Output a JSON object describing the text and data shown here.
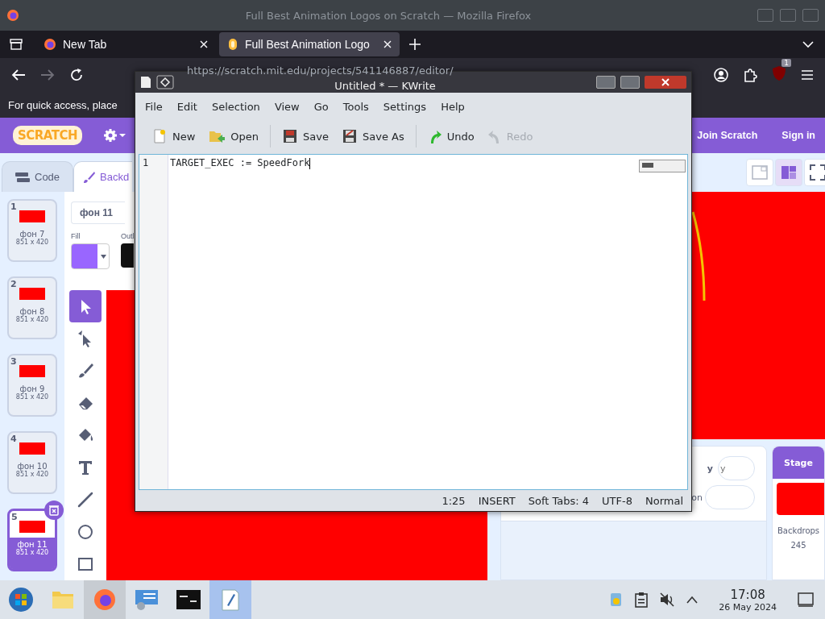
{
  "firefox": {
    "title": "Full Best Animation Logos on Scratch — Mozilla Firefox",
    "tabs": [
      {
        "label": "New Tab",
        "kind": "firefox",
        "selected": false
      },
      {
        "label": "Full Best Animation Logo",
        "kind": "scratch",
        "selected": true
      }
    ],
    "url": "https://scratch.mit.edu/projects/541146887/editor/",
    "extension_badge": "1",
    "bookmarks_hint": "For quick access, place"
  },
  "scratch": {
    "logo": "SCRATCH",
    "header_links": [
      "Join Scratch",
      "Sign in"
    ],
    "editor_tabs": [
      {
        "label": "Code",
        "kind": "code",
        "selected": false
      },
      {
        "label": "Backd",
        "kind": "backdrops",
        "selected": true
      }
    ],
    "stage_modes": [
      {
        "kind": "small",
        "selected": false
      },
      {
        "kind": "normal",
        "selected": true
      },
      {
        "kind": "fullscreen",
        "selected": false
      }
    ],
    "backdrops": [
      {
        "number": "1",
        "name": "фон 7",
        "size": "851 x 420",
        "selected": false
      },
      {
        "number": "2",
        "name": "фон 8",
        "size": "851 x 420",
        "selected": false
      },
      {
        "number": "3",
        "name": "фон 9",
        "size": "851 x 420",
        "selected": false
      },
      {
        "number": "4",
        "name": "фон 10",
        "size": "851 x 420",
        "selected": false
      },
      {
        "number": "5",
        "name": "фон 11",
        "size": "851 x 420",
        "selected": true
      }
    ],
    "costume_name": "фон 11",
    "fill_label": "Fill",
    "fill": {
      "color": "#9966ff"
    },
    "outline_label": "Outl",
    "tools": [
      {
        "kind": "select",
        "selected": true
      },
      {
        "kind": "reshape",
        "selected": false
      },
      {
        "kind": "brush",
        "selected": false
      },
      {
        "kind": "eraser",
        "selected": false
      },
      {
        "kind": "fill",
        "selected": false
      },
      {
        "kind": "text",
        "selected": false
      },
      {
        "kind": "line",
        "selected": false
      },
      {
        "kind": "circle",
        "selected": false
      },
      {
        "kind": "rectangle",
        "selected": false
      }
    ],
    "sprite_info": {
      "direction_label": "on",
      "y_label": "y",
      "y_placeholder": "y"
    },
    "stage_panel": {
      "title": "Stage",
      "backdrops_label": "Backdrops",
      "backdrops_count": "245"
    }
  },
  "kwrite": {
    "title": "Untitled * — KWrite",
    "menu": [
      "File",
      "Edit",
      "Selection",
      "View",
      "Go",
      "Tools",
      "Settings",
      "Help"
    ],
    "toolbar": [
      {
        "label": "New",
        "kind": "new",
        "disabled": false
      },
      {
        "label": "Open",
        "kind": "open",
        "disabled": false
      },
      {
        "label": "Save",
        "kind": "save",
        "disabled": false
      },
      {
        "label": "Save As",
        "kind": "saveas",
        "disabled": false
      },
      {
        "label": "Undo",
        "kind": "undo",
        "disabled": false
      },
      {
        "label": "Redo",
        "kind": "redo",
        "disabled": true
      }
    ],
    "lines": [
      {
        "number": "1",
        "text": "TARGET_EXEC := SpeedFork"
      }
    ],
    "status": [
      "1:25",
      "INSERT",
      "Soft Tabs: 4",
      "UTF-8",
      "Normal"
    ]
  },
  "taskbar": {
    "apps": [
      {
        "kind": "start",
        "running": false,
        "active": false
      },
      {
        "kind": "files",
        "running": false,
        "active": false
      },
      {
        "kind": "firefox",
        "running": true,
        "active": false
      },
      {
        "kind": "settings",
        "running": false,
        "active": false
      },
      {
        "kind": "terminal",
        "running": false,
        "active": false
      },
      {
        "kind": "kwrite",
        "active": true
      }
    ],
    "tray": [
      {
        "kind": "updates"
      },
      {
        "kind": "clipboard"
      },
      {
        "kind": "muted"
      },
      {
        "kind": "expand"
      }
    ],
    "time": "17:08",
    "date": "26 May 2024"
  }
}
